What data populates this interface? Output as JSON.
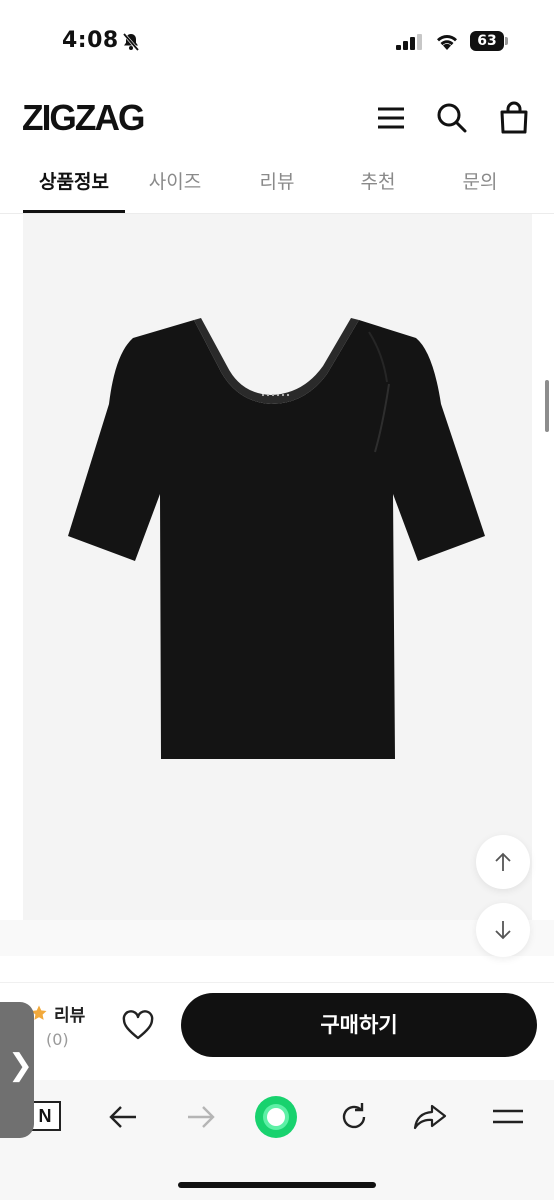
{
  "status_bar": {
    "time": "4:08",
    "battery": "63"
  },
  "header": {
    "logo": "ZIGZAG"
  },
  "tabs": [
    {
      "label": "상품정보"
    },
    {
      "label": "사이즈"
    },
    {
      "label": "리뷰"
    },
    {
      "label": "추천"
    },
    {
      "label": "문의"
    }
  ],
  "active_tab": "상품정보",
  "product": {
    "brand_tag": ""
  },
  "action_bar": {
    "review_label": "리뷰",
    "review_count": "(0)",
    "buy_label": "구매하기"
  },
  "browser_bar": {
    "n_label": "N"
  },
  "side_handle": {
    "glyph": "❯"
  },
  "colors": {
    "accent": "#111111",
    "star": "#f2a93b",
    "refresh_green": "#18d26e"
  }
}
